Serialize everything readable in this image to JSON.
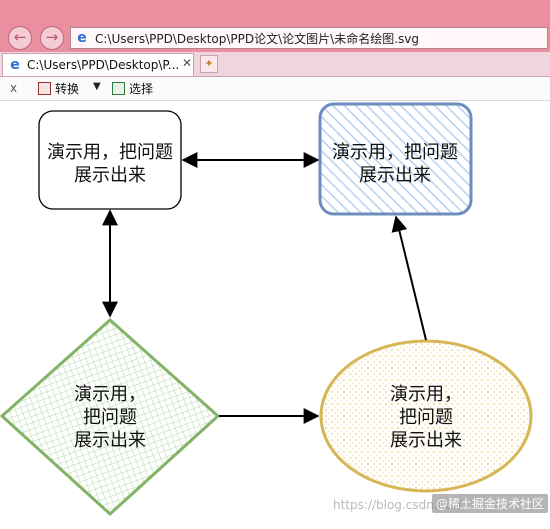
{
  "browser": {
    "address": "C:\\Users\\PPD\\Desktop\\PPD论文\\论文图片\\未命名绘图.svg",
    "back_glyph": "←",
    "forward_glyph": "→",
    "tab_label": "C:\\Users\\PPD\\Desktop\\P...",
    "tab_close": "✕",
    "newtab_glyph": "✦"
  },
  "toolbar": {
    "close": "x",
    "convert_label": "转换",
    "caret": "▼",
    "select_label": "选择"
  },
  "diagram": {
    "box1_line1": "演示用，把问题",
    "box1_line2": "展示出来",
    "box2_line1": "演示用，把问题",
    "box2_line2": "展示出来",
    "diamond_line1": "演示用，",
    "diamond_line2": "把问题",
    "diamond_line3": "展示出来",
    "ellipse_line1": "演示用，",
    "ellipse_line2": "把问题",
    "ellipse_line3": "展示出来",
    "colors": {
      "blue_stroke": "#6c8ebf",
      "blue_fill": "#dae8fc",
      "green_stroke": "#82b366",
      "green_fill": "#d5e8d4",
      "yellow_stroke": "#d6b656",
      "yellow_fill": "#fff2cc"
    }
  },
  "watermark": {
    "url": "https://blog.csdn.net/...",
    "badge": "@稀土掘金技术社区"
  }
}
